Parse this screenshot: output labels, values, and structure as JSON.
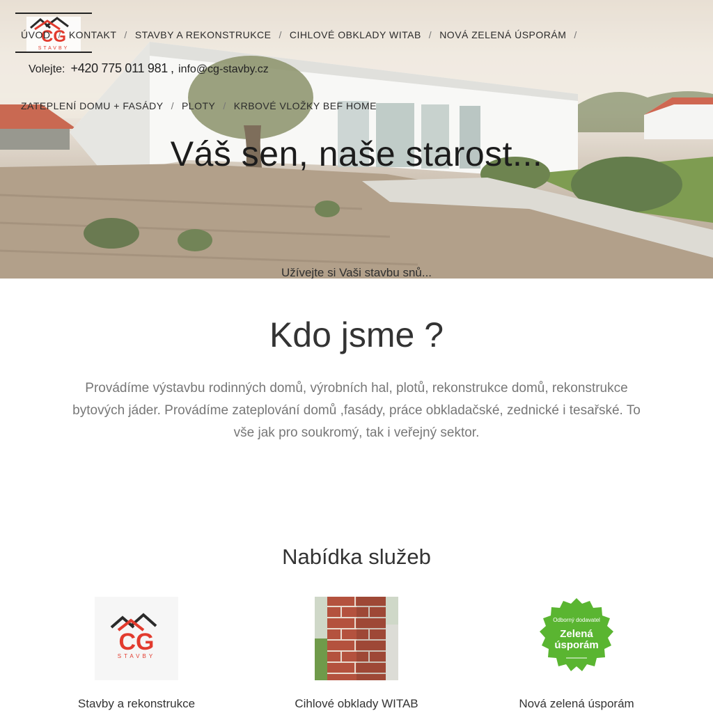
{
  "logo": {
    "letters": "CG",
    "subtitle": "STAVBY"
  },
  "nav": {
    "row1": [
      "ÚVOD",
      "KONTAKT",
      "STAVBY A REKONSTRUKCE",
      "CIHLOVÉ OBKLADY WITAB",
      "NOVÁ ZELENÁ ÚSPORÁM"
    ],
    "row2": [
      "ZATEPLENÍ DOMU + FASÁDY",
      "PLOTY",
      "KRBOVÉ VLOŽKY BEF HOME"
    ]
  },
  "contact": {
    "label": "Volejte:",
    "phone": "+420 775 011 981",
    "comma": ",",
    "email": "info@cg-stavby.cz"
  },
  "hero": {
    "title": "Váš sen, naše starost...",
    "subtitle": "Užívejte si Vaši stavbu snů..."
  },
  "about": {
    "title": "Kdo jsme ?",
    "text": "Provádíme výstavbu rodinných domů, výrobních hal, plotů, rekonstrukce domů, rekonstrukce bytových jáder.  Provádíme zateplování domů ,fasády, práce obkladačské, zednické i tesařské. To vše jak pro soukromý, tak i veřejný sektor."
  },
  "services": {
    "title": "Nabídka služeb",
    "items": [
      {
        "label": "Stavby a rekonstrukce",
        "image": "cg-stavby-logo"
      },
      {
        "label": "Cihlové obklady WITAB",
        "image": "brick-pillar-photo"
      },
      {
        "label": "Nová zelená úsporám",
        "image": "zelena-usporam-badge",
        "badge": {
          "line1": "Odborný dodavatel",
          "line2": "Zelená",
          "line3": "úsporám"
        }
      }
    ]
  },
  "colors": {
    "logo_red": "#e23b2e",
    "logo_dark": "#2a2a2a",
    "badge_green": "#5ab531"
  }
}
